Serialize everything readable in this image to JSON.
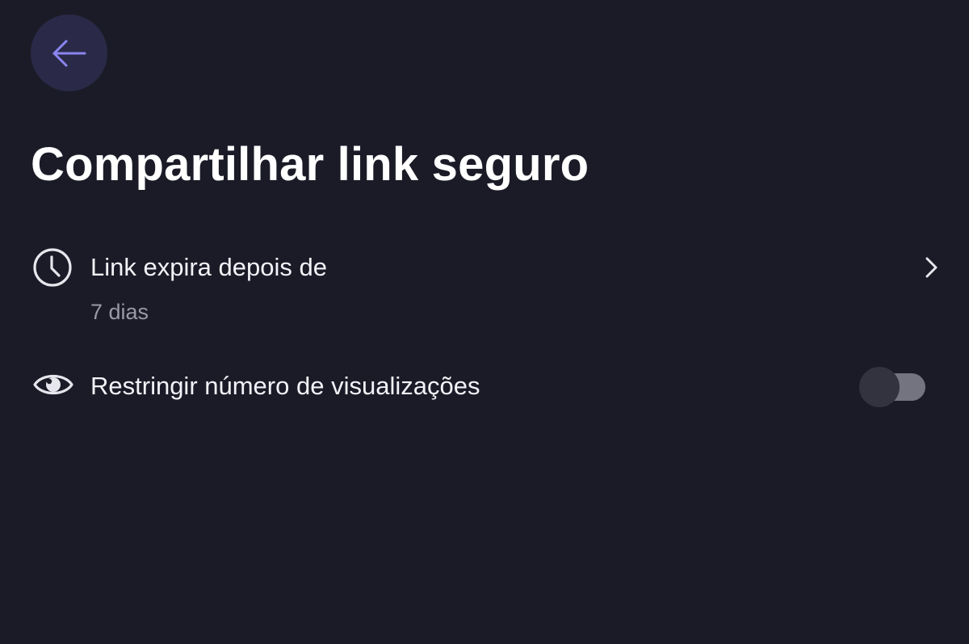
{
  "header": {
    "back_icon": "arrow-left-icon",
    "title": "Compartilhar link seguro"
  },
  "settings": {
    "expiry": {
      "icon": "clock-icon",
      "label": "Link expira depois de",
      "value": "7 dias",
      "trailing_icon": "chevron-right-icon"
    },
    "restrict_views": {
      "icon": "eye-icon",
      "label": "Restringir número de visualizações",
      "enabled": false
    }
  },
  "colors": {
    "background": "#1b1b28",
    "back_button_bg": "#2a2a48",
    "accent": "#8b85f0",
    "primary_text": "#ffffff",
    "secondary_text": "#9a9aa6",
    "toggle_track_off": "#747480",
    "toggle_thumb_off": "#33333f"
  }
}
